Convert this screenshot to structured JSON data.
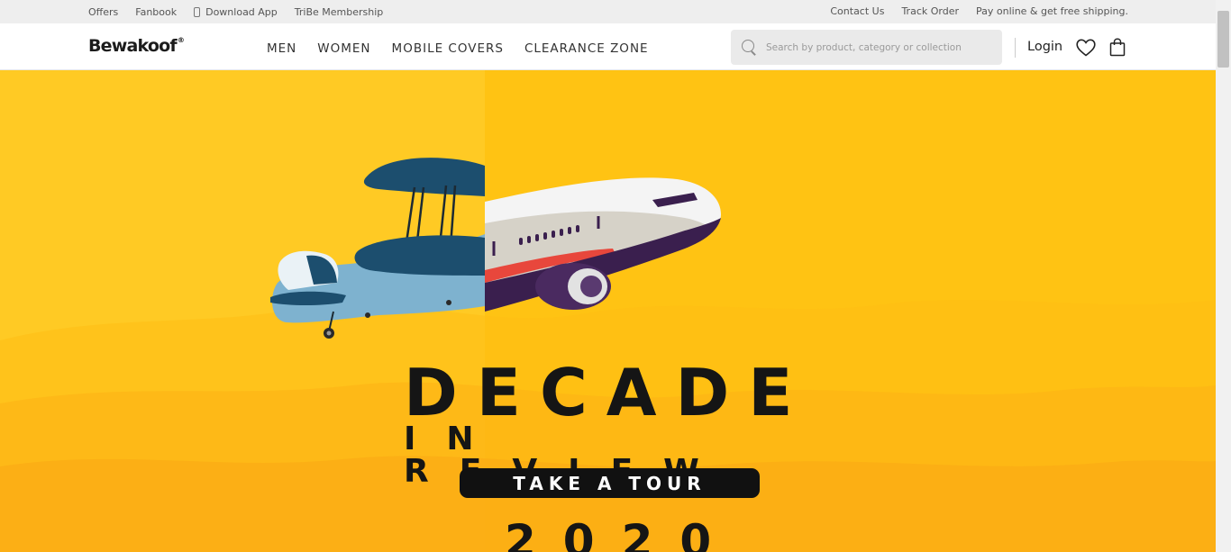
{
  "topbar": {
    "left_links": [
      "Offers",
      "Fanbook"
    ],
    "download_app": "Download App",
    "tribe": "TriBe Membership",
    "right_links": [
      "Contact Us",
      "Track Order",
      "Pay online & get free shipping."
    ]
  },
  "header": {
    "logo": "Bewakoof",
    "logo_mark": "®",
    "nav": [
      "MEN",
      "WOMEN",
      "MOBILE COVERS",
      "CLEARANCE ZONE"
    ],
    "search_placeholder": "Search by product, category or collection",
    "login": "Login",
    "icons": [
      "search-icon",
      "heart-icon",
      "bag-icon"
    ]
  },
  "hero": {
    "headline": "DECADE",
    "subheadline": "IN REVIEW",
    "cta": "TAKE A TOUR",
    "year": "2020",
    "colors": {
      "background": "#ffc313",
      "text": "#151515",
      "cta_bg": "#111111",
      "cta_text": "#ffffff"
    }
  }
}
